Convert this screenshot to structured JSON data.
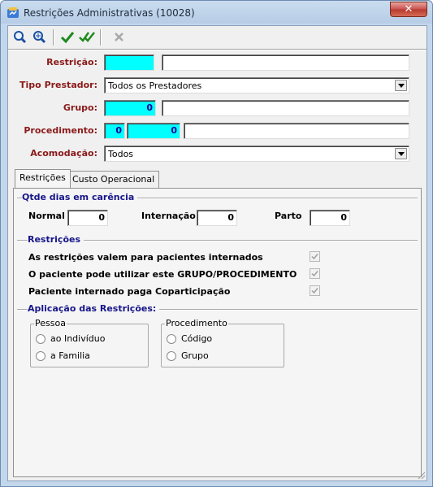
{
  "window": {
    "title": "Restrições Administrativas (10028)",
    "close_glyph": "✕"
  },
  "toolbar": {
    "icons": [
      "search-icon",
      "search-next-icon",
      "check-icon",
      "check-all-icon",
      "delete-icon"
    ]
  },
  "form": {
    "restricao": {
      "label": "Restrição:",
      "code": "",
      "description": ""
    },
    "tipo_prestador": {
      "label": "Tipo Prestador:",
      "selected": "Todos os Prestadores"
    },
    "grupo": {
      "label": "Grupo:",
      "code": "0",
      "description": ""
    },
    "procedimento": {
      "label": "Procedimento:",
      "code1": "0",
      "code2": "0",
      "description": ""
    },
    "acomodacao": {
      "label": "Acomodação:",
      "selected": "Todos"
    }
  },
  "tabs": [
    {
      "label": "Restrições",
      "active": true
    },
    {
      "label": "Custo Operacional",
      "active": false
    }
  ],
  "carencia": {
    "title": "Qtde dias em carência",
    "normal_label": "Normal",
    "normal_value": "0",
    "internacao_label": "Internação",
    "internacao_value": "0",
    "parto_label": "Parto",
    "parto_value": "0"
  },
  "restricoes": {
    "title": "Restrições",
    "items": [
      {
        "label": "As restrições valem para pacientes internados",
        "checked": true
      },
      {
        "label": "O paciente pode utilizar este GRUPO/PROCEDIMENTO",
        "checked": true
      },
      {
        "label": "Paciente internado paga Coparticipação",
        "checked": true
      }
    ]
  },
  "aplicacao": {
    "title": "Aplicação das Restrições:",
    "pessoa": {
      "legend": "Pessoa",
      "options": [
        "ao Indivíduo",
        "a Familia"
      ]
    },
    "procedimento": {
      "legend": "Procedimento",
      "options": [
        "Código",
        "Grupo"
      ]
    }
  },
  "colors": {
    "label_red": "#8b1a1a",
    "group_blue": "#17168a",
    "cyan_field": "#00ffff",
    "check_green": "#1e8a1e"
  }
}
